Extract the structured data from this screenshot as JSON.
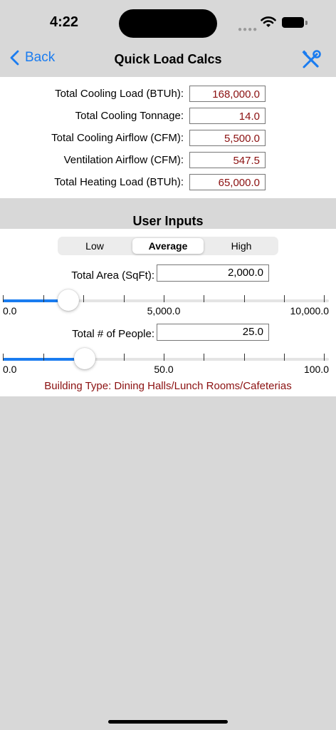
{
  "status": {
    "time": "4:22"
  },
  "nav": {
    "back_label": "Back",
    "title": "Quick Load Calcs"
  },
  "results": [
    {
      "label": "Total Cooling Load (BTUh):",
      "value": "168,000.0"
    },
    {
      "label": "Total Cooling Tonnage:",
      "value": "14.0"
    },
    {
      "label": "Total Cooling Airflow (CFM):",
      "value": "5,500.0"
    },
    {
      "label": "Ventilation Airflow (CFM):",
      "value": "547.5"
    },
    {
      "label": "Total Heating Load (BTUh):",
      "value": "65,000.0"
    }
  ],
  "user_inputs": {
    "title": "User Inputs",
    "segments": [
      "Low",
      "Average",
      "High"
    ],
    "selected_segment": "Average",
    "area": {
      "label": "Total Area (SqFt):",
      "value": "2,000.0",
      "slider_fraction": 0.2,
      "min_label": "0.0",
      "mid_label": "5,000.0",
      "max_label": "10,000.0"
    },
    "people": {
      "label": "Total # of People:",
      "value": "25.0",
      "slider_fraction": 0.25,
      "min_label": "0.0",
      "mid_label": "50.0",
      "max_label": "100.0"
    },
    "building_type": "Building Type: Dining Halls/Lunch Rooms/Cafeterias"
  },
  "colors": {
    "accent": "#1a7cf0",
    "value_red": "#8b1010"
  },
  "icons": {
    "back": "chevron-left-icon",
    "settings": "wrench-screwdriver-icon"
  }
}
